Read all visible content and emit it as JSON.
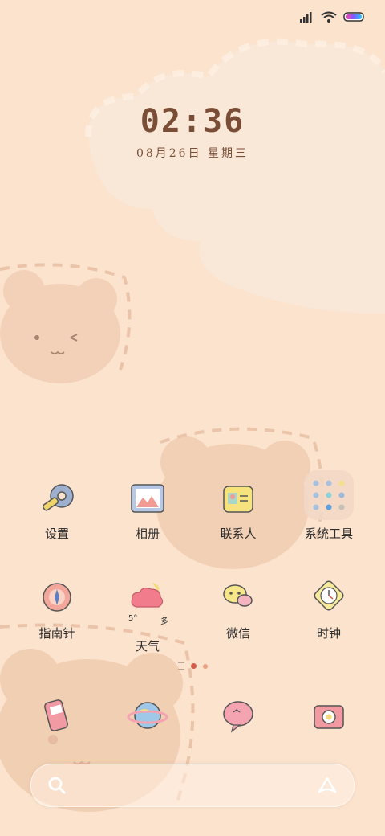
{
  "lock": {
    "time": "02:36",
    "date": "08月26日  星期三"
  },
  "apps": {
    "row1": [
      {
        "label": "设置",
        "icon": "gear-wrench-icon"
      },
      {
        "label": "相册",
        "icon": "photo-frame-icon"
      },
      {
        "label": "联系人",
        "icon": "contact-card-icon"
      },
      {
        "label": "系统工具",
        "icon": "folder-icon"
      }
    ],
    "row2": [
      {
        "label": "指南针",
        "icon": "compass-icon"
      },
      {
        "label": "天气",
        "icon": "weather-cloud-icon"
      },
      {
        "label": "微信",
        "icon": "chat-bubbles-icon"
      },
      {
        "label": "时钟",
        "icon": "clock-icon"
      }
    ],
    "weather_widget": {
      "temp": "5°",
      "cond": "多"
    },
    "dock": [
      {
        "icon": "phone-icon"
      },
      {
        "icon": "browser-planet-icon"
      },
      {
        "icon": "message-heart-icon"
      },
      {
        "icon": "camera-icon"
      }
    ]
  },
  "pager": {
    "pages": 2,
    "current": 0
  },
  "colors": {
    "background": "#fbe3ce",
    "clock": "#7a4e36",
    "accent": "#d45b4a"
  }
}
